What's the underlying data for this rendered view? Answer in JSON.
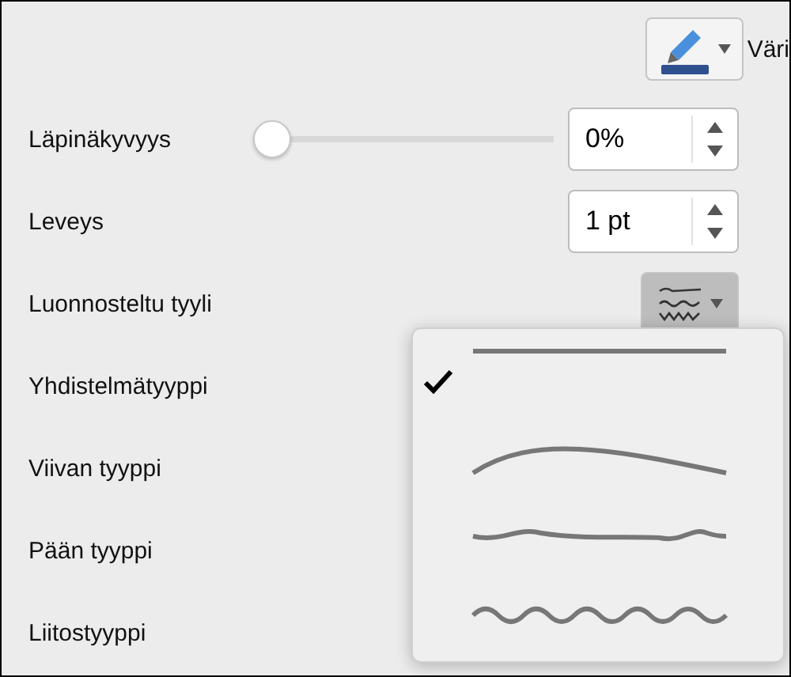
{
  "color_control": {
    "label": "Väri"
  },
  "rows": [
    {
      "kind": "slider",
      "label": "Läpinäkyvyys",
      "level": 0,
      "value": "0%"
    },
    {
      "kind": "spinner",
      "label": "Leveys",
      "value": "1 pt"
    },
    {
      "kind": "sketch",
      "label": "Luonnosteltu tyyli",
      "expanded": true
    },
    {
      "kind": "plain",
      "label": "Yhdistelmätyyppi"
    },
    {
      "kind": "plain",
      "label": "Viivan tyyppi"
    },
    {
      "kind": "plain",
      "label": "Pään tyyppi"
    },
    {
      "kind": "plain",
      "label": "Liitostyyppi"
    }
  ],
  "sketch_menu": {
    "options": [
      {
        "kind": "straight",
        "selected": true
      },
      {
        "kind": "curve",
        "selected": false
      },
      {
        "kind": "freehand",
        "selected": false
      },
      {
        "kind": "scribble",
        "selected": false
      }
    ]
  }
}
